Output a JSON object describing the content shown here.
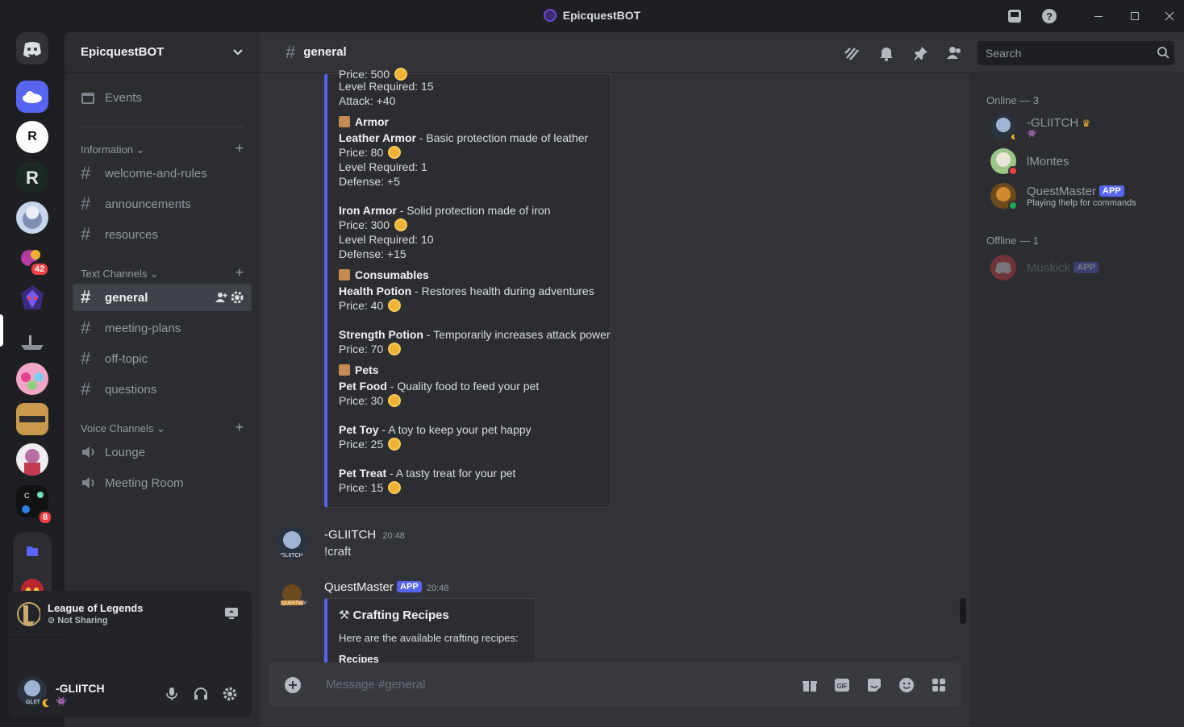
{
  "window": {
    "title": "EpicquestBOT"
  },
  "servers": {
    "badges": [
      "42",
      "8"
    ]
  },
  "guild": {
    "name": "EpicquestBOT"
  },
  "sidebar": {
    "events": "Events",
    "cat_info": "Information",
    "info_channels": [
      "welcome-and-rules",
      "announcements",
      "resources"
    ],
    "cat_text": "Text Channels",
    "text_channels": [
      "general",
      "meeting-plans",
      "off-topic",
      "questions"
    ],
    "cat_voice": "Voice Channels",
    "voice_channels": [
      "Lounge",
      "Meeting Room"
    ]
  },
  "activity": {
    "game": "League of Legends",
    "status": "Not Sharing"
  },
  "user": {
    "name": "-GLIITCH"
  },
  "chat": {
    "channel": "general",
    "shop_embed": {
      "weapon_tail": [
        "Level Required: 15",
        "Attack: +40"
      ],
      "armor_title": "Armor",
      "leather_name": "Leather Armor",
      "leather_desc": "- Basic protection made of leather",
      "leather_price": "Price: 80",
      "leather_level": "Level Required: 1",
      "leather_def": "Defense: +5",
      "iron_name": "Iron Armor",
      "iron_desc": "- Solid protection made of iron",
      "iron_price": "Price: 300",
      "iron_level": "Level Required: 10",
      "iron_def": "Defense: +15",
      "cons_title": "Consumables",
      "hp_name": "Health Potion",
      "hp_desc": "- Restores health during adventures",
      "hp_price": "Price: 40",
      "sp_name": "Strength Potion",
      "sp_desc": "- Temporarily increases attack power",
      "sp_price": "Price: 70",
      "pets_title": "Pets",
      "pf_name": "Pet Food",
      "pf_desc": "- Quality food to feed your pet",
      "pf_price": "Price: 30",
      "pt_name": "Pet Toy",
      "pt_desc": "- A toy to keep your pet happy",
      "pt_price": "Price: 25",
      "ptr_name": "Pet Treat",
      "ptr_desc": "- A tasty treat for your pet",
      "ptr_price": "Price: 15"
    },
    "msg1": {
      "author": "-GLIITCH",
      "time": "20:48",
      "text": "!craft"
    },
    "msg2": {
      "author": "QuestMaster",
      "tag": "APP",
      "time": "20:48",
      "embed_title": "Crafting Recipes",
      "embed_desc": "Here are the available crafting recipes:",
      "embed_sub": "Recipes"
    },
    "composer_placeholder": "Message #general"
  },
  "search": {
    "placeholder": "Search"
  },
  "members": {
    "online_header": "Online — 3",
    "online": [
      {
        "name": "-GLIITCH"
      },
      {
        "name": "lMontes"
      },
      {
        "name": "QuestMaster",
        "tag": "APP",
        "activity": "Playing !help for commands"
      }
    ],
    "offline_header": "Offline — 1",
    "offline": [
      {
        "name": "Muskick",
        "tag": "APP"
      }
    ]
  },
  "colors": {
    "accent": "#5865f2",
    "online": "#23a55a",
    "dnd": "#f23f43",
    "coin": "#f0b232"
  }
}
